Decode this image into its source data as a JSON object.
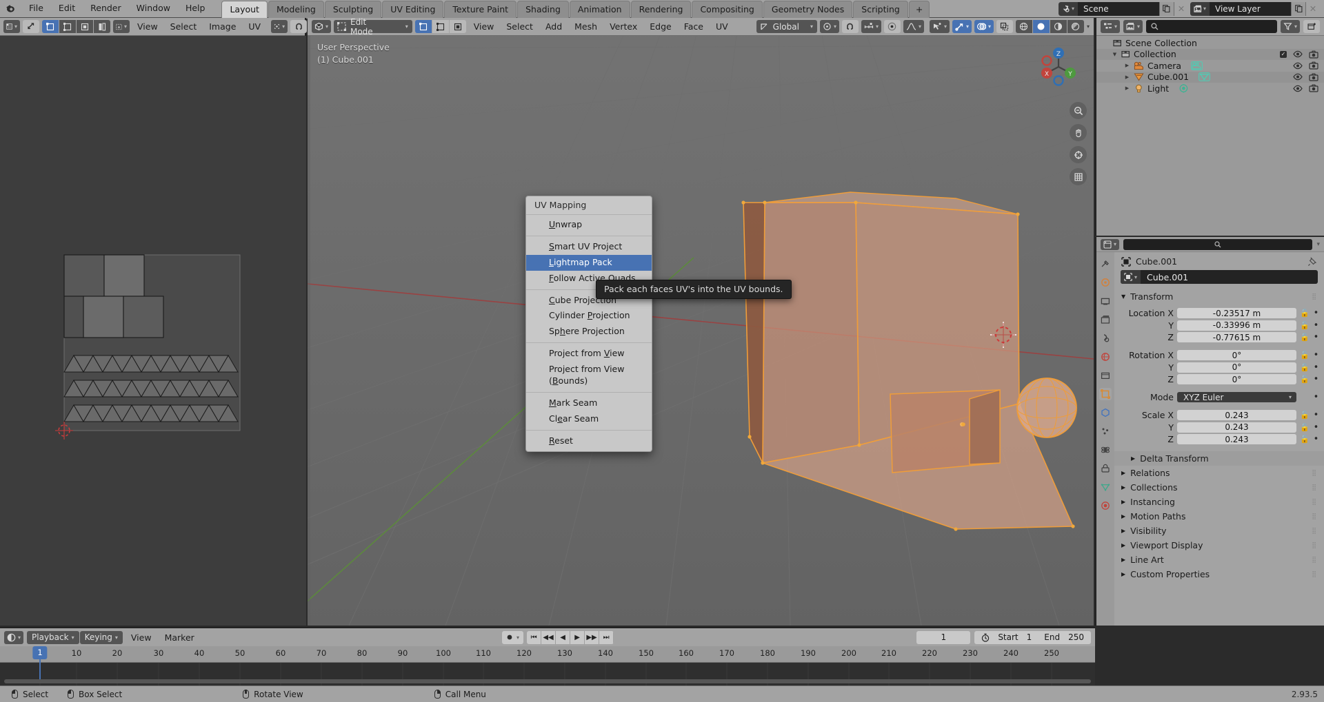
{
  "app": {
    "version": "2.93.5"
  },
  "topbar": {
    "logo_icon": "blender-logo-icon",
    "menus": [
      "File",
      "Edit",
      "Render",
      "Window",
      "Help"
    ],
    "workspace_tabs": [
      {
        "label": "Layout",
        "active": true
      },
      {
        "label": "Modeling",
        "active": false
      },
      {
        "label": "Sculpting",
        "active": false
      },
      {
        "label": "UV Editing",
        "active": false
      },
      {
        "label": "Texture Paint",
        "active": false
      },
      {
        "label": "Shading",
        "active": false
      },
      {
        "label": "Animation",
        "active": false
      },
      {
        "label": "Rendering",
        "active": false
      },
      {
        "label": "Compositing",
        "active": false
      },
      {
        "label": "Geometry Nodes",
        "active": false
      },
      {
        "label": "Scripting",
        "active": false
      }
    ],
    "add_workspace_label": "+",
    "scene": {
      "icon": "scene-icon",
      "name": "Scene",
      "new_icon": "duplicate-icon",
      "unlink_icon": "x-icon"
    },
    "view_layer": {
      "icon": "view-layer-icon",
      "name": "View Layer",
      "new_icon": "duplicate-icon",
      "unlink_icon": "x-icon"
    }
  },
  "uv_editor": {
    "editor_type_icon": "uv-editor-icon",
    "sync_icon": "uv-sync-icon",
    "select_modes": [
      "vertex-select-icon",
      "edge-select-icon",
      "face-select-icon",
      "island-select-icon"
    ],
    "sticky_icon": "sticky-selection-icon",
    "menus": [
      "View",
      "Select",
      "Image",
      "UV"
    ],
    "pivot_icon": "pivot-icon",
    "snap_icon": "snap-magnet-icon",
    "proportional_icon": "proportional-edit-icon"
  },
  "viewport": {
    "editor_type_icon": "3d-viewport-icon",
    "mode": "Edit Mode",
    "mode_icon": "edit-mode-icon",
    "select_modes": [
      "vertex-select-icon",
      "edge-select-icon",
      "face-select-icon"
    ],
    "menus": [
      "View",
      "Select",
      "Add",
      "Mesh",
      "Vertex",
      "Edge",
      "Face",
      "UV"
    ],
    "transform_orientation": {
      "icon": "orientation-icon",
      "value": "Global"
    },
    "pivot_icon": "pivot-icon",
    "snap_icon": "snap-magnet-icon",
    "snap_mode_icon": "snap-increment-icon",
    "proportional_icon": "proportional-edit-icon",
    "falloff_icon": "falloff-curve-icon",
    "visibility_icon": "object-visibility-icon",
    "gizmo_icon": "gizmo-icon",
    "overlay_icon": "overlays-icon",
    "xray_icon": "xray-icon",
    "shading_modes": [
      "wireframe-shading-icon",
      "solid-shading-icon",
      "material-shading-icon",
      "rendered-shading-icon"
    ],
    "header_text_line1": "User Perspective",
    "header_text_line2": "(1) Cube.001",
    "gizmo_buttons": [
      "zoom-icon",
      "move-hand-icon",
      "camera-icon",
      "ortho-persp-icon"
    ],
    "nav_axes": [
      "X",
      "Y",
      "Z"
    ]
  },
  "uv_menu": {
    "title": "UV Mapping",
    "groups": [
      [
        {
          "label": "Unwrap",
          "underline_index": 0,
          "selected": false
        }
      ],
      [
        {
          "label": "Smart UV Project",
          "underline_index": 0,
          "selected": false
        },
        {
          "label": "Lightmap Pack",
          "underline_index": 0,
          "selected": true
        },
        {
          "label": "Follow Active Quads",
          "underline_index": 0,
          "selected": false
        }
      ],
      [
        {
          "label": "Cube Projection",
          "underline_index": 0,
          "selected": false
        },
        {
          "label": "Cylinder Projection",
          "underline_index": 9,
          "selected": false
        },
        {
          "label": "Sphere Projection",
          "underline_index": 2,
          "selected": false
        }
      ],
      [
        {
          "label": "Project from View",
          "underline_index": 13,
          "selected": false
        },
        {
          "label": "Project from View (Bounds)",
          "underline_index": 19,
          "selected": false
        }
      ],
      [
        {
          "label": "Mark Seam",
          "underline_index": 0,
          "selected": false
        },
        {
          "label": "Clear Seam",
          "underline_index": 2,
          "selected": false
        }
      ],
      [
        {
          "label": "Reset",
          "underline_index": 0,
          "selected": false
        }
      ]
    ]
  },
  "tooltip": {
    "text": "Pack each faces UV's into the UV bounds."
  },
  "outliner": {
    "display_mode_icon": "outliner-display-icon",
    "filter_id_icon": "filter-id-icon",
    "search_placeholder": "",
    "search_icon": "search-icon",
    "filter_icon": "funnel-icon",
    "new_collection_icon": "new-collection-icon",
    "rows": [
      {
        "label": "Scene Collection",
        "icon": "collection-icon",
        "depth": 0,
        "expandable": false,
        "has_checkbox": false,
        "has_eye": false,
        "has_camera": false
      },
      {
        "label": "Collection",
        "icon": "collection-icon",
        "depth": 1,
        "expandable": true,
        "expanded": true,
        "has_checkbox": true,
        "has_eye": true,
        "has_camera": true
      },
      {
        "label": "Camera",
        "icon": "camera-object-icon",
        "data_icon": "camera-data-icon",
        "depth": 2,
        "expandable": true,
        "expanded": false,
        "has_checkbox": false,
        "has_eye": true,
        "has_camera": true
      },
      {
        "label": "Cube.001",
        "icon": "mesh-object-icon",
        "data_icon": "mesh-data-icon",
        "depth": 2,
        "expandable": true,
        "expanded": false,
        "has_checkbox": false,
        "has_eye": true,
        "has_camera": true
      },
      {
        "label": "Light",
        "icon": "light-object-icon",
        "data_icon": "light-data-icon",
        "depth": 2,
        "expandable": true,
        "expanded": false,
        "has_checkbox": false,
        "has_eye": true,
        "has_camera": true
      }
    ]
  },
  "properties": {
    "editor_type_icon": "properties-editor-icon",
    "search_icon": "search-icon",
    "tabs": [
      "tool-icon",
      "render-icon",
      "output-icon",
      "view-layer-icon",
      "scene-icon",
      "world-icon",
      "collection-properties-icon",
      "object-icon",
      "modifier-icon",
      "particles-icon",
      "physics-icon",
      "constraints-icon",
      "data-icon",
      "material-icon"
    ],
    "active_tab_index": 7,
    "breadcrumb": "Cube.001",
    "breadcrumb_icon": "object-icon",
    "pin_icon": "pin-icon",
    "name_field": {
      "value": "Cube.001",
      "icon": "object-icon"
    },
    "transform_panel": {
      "title": "Transform",
      "rows": [
        {
          "label": "Location X",
          "value": "-0.23517 m",
          "type": "num"
        },
        {
          "label": "Y",
          "value": "-0.33996 m",
          "type": "num"
        },
        {
          "label": "Z",
          "value": "-0.77615 m",
          "type": "num"
        },
        {
          "label": "Rotation X",
          "value": "0°",
          "type": "num"
        },
        {
          "label": "Y",
          "value": "0°",
          "type": "num"
        },
        {
          "label": "Z",
          "value": "0°",
          "type": "num"
        },
        {
          "label": "Mode",
          "value": "XYZ Euler",
          "type": "dropdown"
        },
        {
          "label": "Scale X",
          "value": "0.243",
          "type": "num"
        },
        {
          "label": "Y",
          "value": "0.243",
          "type": "num"
        },
        {
          "label": "Z",
          "value": "0.243",
          "type": "num"
        }
      ]
    },
    "collapsed_panels": [
      {
        "label": "Delta Transform",
        "sub": true
      },
      {
        "label": "Relations",
        "sub": false
      },
      {
        "label": "Collections",
        "sub": false
      },
      {
        "label": "Instancing",
        "sub": false
      },
      {
        "label": "Motion Paths",
        "sub": false
      },
      {
        "label": "Visibility",
        "sub": false
      },
      {
        "label": "Viewport Display",
        "sub": false
      },
      {
        "label": "Line Art",
        "sub": false
      },
      {
        "label": "Custom Properties",
        "sub": false
      }
    ]
  },
  "timeline": {
    "editor_type_icon": "timeline-editor-icon",
    "playback_label": "Playback",
    "keying_label": "Keying",
    "menus": [
      "View",
      "Marker"
    ],
    "record_icon": "record-icon",
    "transport_icons": [
      "jump-start-icon",
      "prev-keyframe-icon",
      "play-reverse-icon",
      "play-icon",
      "next-keyframe-icon",
      "jump-end-icon"
    ],
    "current_frame": "1",
    "start_label": "Start",
    "start_value": "1",
    "end_label": "End",
    "end_value": "250",
    "frame_icon": "stopwatch-icon",
    "ruler_ticks": [
      "1",
      "10",
      "20",
      "30",
      "40",
      "50",
      "60",
      "70",
      "80",
      "90",
      "100",
      "110",
      "120",
      "130",
      "140",
      "150",
      "160",
      "170",
      "180",
      "190",
      "200",
      "210",
      "220",
      "230",
      "240",
      "250"
    ],
    "playhead_frame": "1"
  },
  "statusbar": {
    "items": [
      {
        "icon": "mouse-left-icon",
        "label": "Select"
      },
      {
        "icon": "mouse-left-drag-icon",
        "label": "Box Select"
      },
      {
        "icon": "mouse-middle-icon",
        "label": "Rotate View"
      },
      {
        "icon": "mouse-right-icon",
        "label": "Call Menu"
      }
    ],
    "version": "2.93.5"
  },
  "colors": {
    "accent_blue": "#4772b3",
    "header_gray": "#a3a3a3",
    "viewport_bg": "#6b6b6b",
    "mesh_orange": "#e79a3c",
    "selected_face": "#d9a88f"
  }
}
